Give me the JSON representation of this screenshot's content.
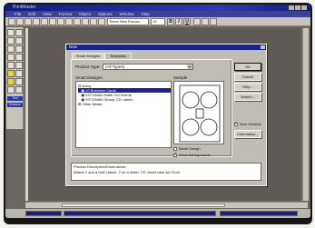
{
  "app": {
    "window_title": "PrintMaster"
  },
  "menus": [
    "File",
    "Edit",
    "View",
    "Format",
    "Object",
    "Options",
    "Window",
    "Help"
  ],
  "toolbar": {
    "font_name": "Times New Roman",
    "font_size": "10",
    "bold": "B",
    "italic": "I",
    "underline": "U"
  },
  "palette": {
    "label_a": "Text",
    "label_b": "Shadow"
  },
  "dialog": {
    "title": "New",
    "tabs": [
      "Smart Designs",
      "Templates"
    ],
    "product_type_label": "Product Type:",
    "product_type_value": "(All Types)",
    "smart_designs_label": "Smart Designs:",
    "sample_label": "Sample",
    "items": [
      "Avery",
      "10 Business Cards",
      "5371/5881 Matte 2x2 Inserts",
      "5372/5883 Glossy CD Labels",
      "Other Media"
    ],
    "blank_design": "Blank Design",
    "show_backgrounds": "Show Backgrounds",
    "buttons": [
      "OK",
      "Cancel",
      "Help...",
      "Search..."
    ],
    "new_window": "New Window",
    "info_button": "Information...",
    "description_header": "Product Description/Dimensions:",
    "description_text": "Makes 1 and a Half Labels. 2 on a sheet. CD Jewel case Art Front"
  },
  "colors": {
    "title_blue": "#1b2394",
    "desk_gray": "#5f5a55",
    "selection": "#1b2394"
  }
}
